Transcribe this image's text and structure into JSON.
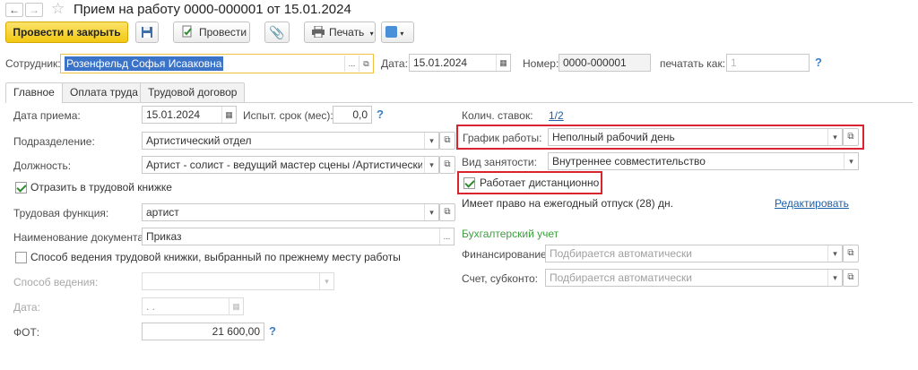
{
  "window": {
    "title": "Прием на работу 0000-000001 от 15.01.2024"
  },
  "toolbar": {
    "post_close": "Провести и закрыть",
    "post": "Провести",
    "print": "Печать"
  },
  "header": {
    "employee_label": "Сотрудник:",
    "employee_value": "Розенфельд Софья Исааковна",
    "date_label": "Дата:",
    "date_value": "15.01.2024",
    "number_label": "Номер:",
    "number_value": "0000-000001",
    "print_as_label": "печатать как:",
    "print_as_value": "1",
    "help": "?"
  },
  "tabs": [
    "Главное",
    "Оплата труда",
    "Трудовой договор"
  ],
  "left": {
    "hire_date_label": "Дата приема:",
    "hire_date_value": "15.01.2024",
    "probation_label": "Испыт. срок (мес):",
    "probation_value": "0,0",
    "department_label": "Подразделение:",
    "department_value": "Артистический отдел",
    "position_label": "Должность:",
    "position_value": "Артист - солист - ведущий мастер сцены /Артистический о",
    "workbook_check_label": "Отразить в трудовой книжке",
    "function_label": "Трудовая функция:",
    "function_value": "артист",
    "docname_label": "Наименование документа:",
    "docname_value": "Приказ",
    "method_prev_label": "Способ ведения трудовой книжки, выбранный по прежнему месту работы",
    "method_label": "Способ ведения:",
    "date2_label": "Дата:",
    "date2_value": " .  .",
    "fot_label": "ФОТ:",
    "fot_value": "21 600,00",
    "help": "?"
  },
  "right": {
    "rates_label": "Колич. ставок:",
    "rates_value": "1/2",
    "schedule_label": "График работы:",
    "schedule_value": "Неполный рабочий день",
    "employment_label": "Вид занятости:",
    "employment_value": "Внутреннее совместительство",
    "remote_label": "Работает дистанционно",
    "vacation_text": "Имеет право на ежегодный отпуск (28) дн.",
    "edit_link": "Редактировать",
    "accounting_title": "Бухгалтерский учет",
    "financing_label": "Финансирование:",
    "financing_placeholder": "Подбирается автоматически",
    "account_label": "Счет, субконто:",
    "account_placeholder": "Подбирается автоматически"
  },
  "colors": {
    "primary_button": "#f6d533",
    "highlight_border": "#d9232e",
    "link": "#1f5fa8",
    "section_title": "#3f9e3f"
  }
}
